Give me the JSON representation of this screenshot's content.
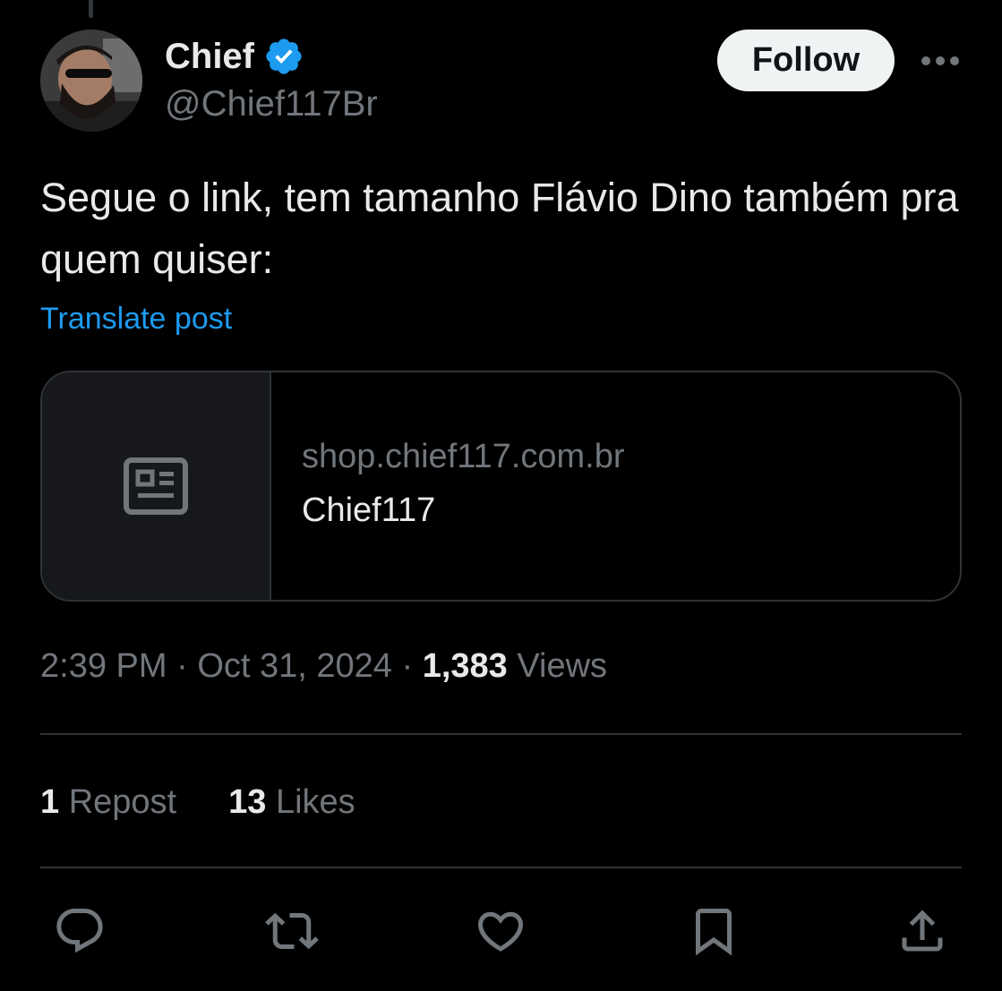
{
  "author": {
    "display_name": "Chief",
    "handle": "@Chief117Br",
    "verified": true
  },
  "header": {
    "follow_label": "Follow"
  },
  "post": {
    "text": "Segue o link, tem tamanho Flávio Dino também pra quem quiser:",
    "translate_label": "Translate post"
  },
  "link_card": {
    "domain": "shop.chief117.com.br",
    "title": "Chief117"
  },
  "meta": {
    "time": "2:39 PM",
    "date": "Oct 31, 2024",
    "separator": "·",
    "views_count": "1,383",
    "views_label": "Views"
  },
  "stats": {
    "reposts_count": "1",
    "reposts_label": "Repost",
    "likes_count": "13",
    "likes_label": "Likes"
  },
  "actions": [
    "reply-icon",
    "repost-icon",
    "like-icon",
    "bookmark-icon",
    "share-icon"
  ],
  "colors": {
    "background": "#000000",
    "accent": "#1d9bf0",
    "text_primary": "#e7e9ea",
    "text_secondary": "#71767b",
    "border": "#2f3336"
  }
}
